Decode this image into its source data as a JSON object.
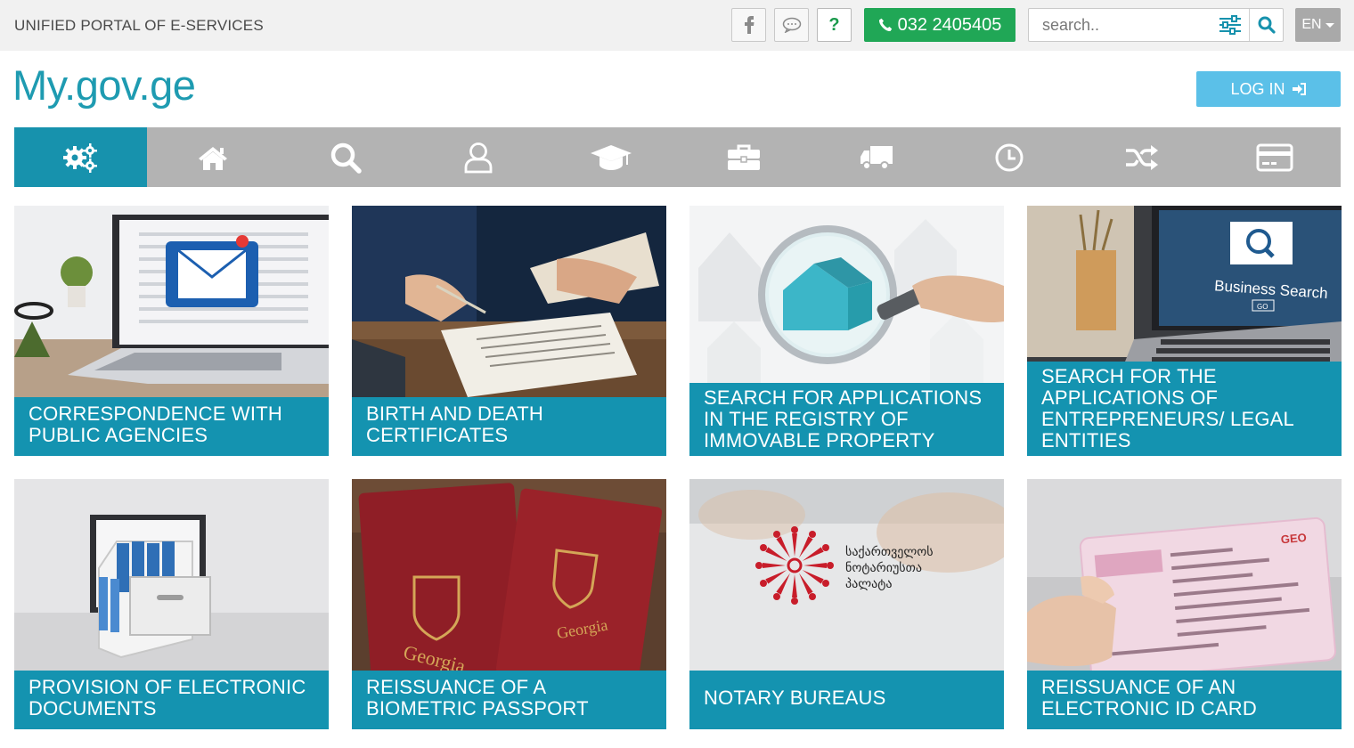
{
  "header": {
    "portal_title": "UNIFIED PORTAL OF E-SERVICES",
    "phone": "032 2405405",
    "search_placeholder": "search..",
    "language": "EN",
    "help_label": "?"
  },
  "brand": {
    "logo": "My.gov.ge",
    "login_label": "LOG IN"
  },
  "nav": {
    "items": [
      {
        "icon": "gears-icon",
        "active": true
      },
      {
        "icon": "home-icon"
      },
      {
        "icon": "search-icon"
      },
      {
        "icon": "user-icon"
      },
      {
        "icon": "graduation-cap-icon"
      },
      {
        "icon": "briefcase-icon"
      },
      {
        "icon": "truck-icon"
      },
      {
        "icon": "clock-icon"
      },
      {
        "icon": "random-icon"
      },
      {
        "icon": "credit-card-icon"
      }
    ]
  },
  "cards": [
    {
      "title": "CORRESPONDENCE WITH PUBLIC AGENCIES"
    },
    {
      "title": "BIRTH AND DEATH CERTIFICATES"
    },
    {
      "title": "SEARCH FOR APPLICATIONS IN THE REGISTRY OF IMMOVABLE PROPERTY"
    },
    {
      "title": "SEARCH FOR THE APPLICATIONS OF ENTREPRENEURS/ LEGAL ENTITIES"
    },
    {
      "title": "PROVISION OF ELECTRONIC DOCUMENTS"
    },
    {
      "title": "REISSUANCE OF A BIOMETRIC PASSPORT"
    },
    {
      "title": "NOTARY BUREAUS"
    },
    {
      "title": "REISSUANCE OF AN ELECTRONIC ID CARD"
    }
  ],
  "card_images": {
    "business_search_text": "Business Search",
    "business_go_text": "GO",
    "passport_country": "Georgia",
    "notary_line_1": "საქართველოს",
    "notary_line_2": "ნოტარიუსთა",
    "notary_line_3": "პალატა",
    "id_card_code": "GEO"
  },
  "colors": {
    "primary": "#1493b0",
    "nav_bg": "#b3b3b3",
    "nav_active": "#1792ad",
    "phone_green": "#20a756",
    "login_blue": "#5bc0e8",
    "logo_teal": "#1e9bb1"
  }
}
